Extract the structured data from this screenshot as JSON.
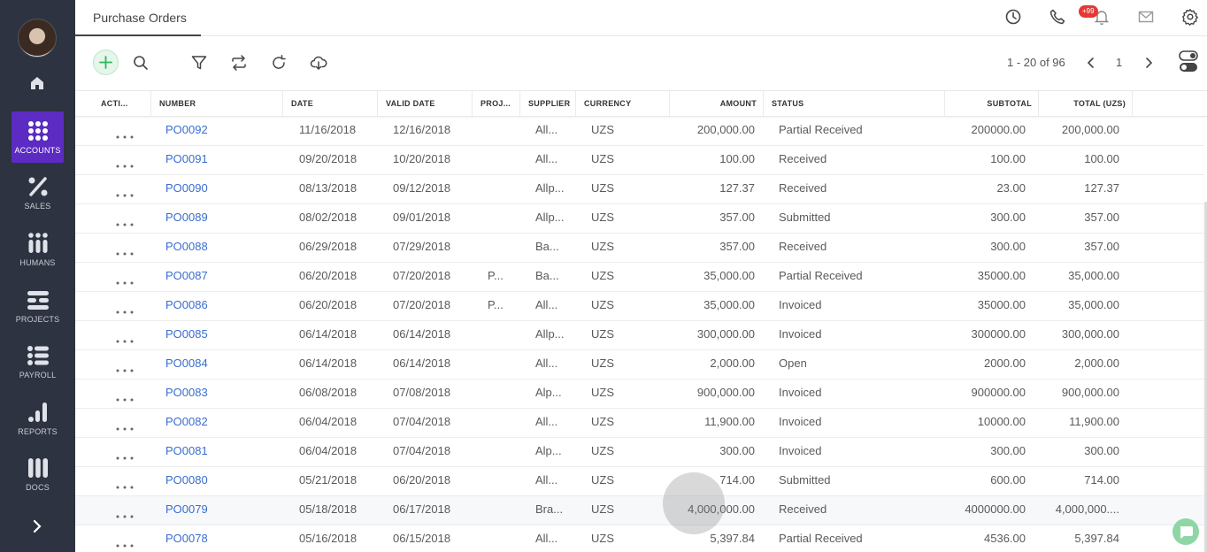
{
  "sidebar": {
    "items": [
      {
        "label": "ACCOUNTS",
        "icon": "grid-dots-icon"
      },
      {
        "label": "SALES",
        "icon": "percent-icon"
      },
      {
        "label": "HUMANS",
        "icon": "people-icon"
      },
      {
        "label": "PROJECTS",
        "icon": "projects-icon"
      },
      {
        "label": "PAYROLL",
        "icon": "payroll-list-icon"
      },
      {
        "label": "REPORTS",
        "icon": "bar-chart-icon"
      },
      {
        "label": "DOCS",
        "icon": "docs-icon"
      }
    ]
  },
  "header": {
    "tab": "Purchase Orders",
    "notification_badge": "+99"
  },
  "toolbar": {
    "pager_range": "1 - 20 of 96",
    "page_number": "1"
  },
  "table": {
    "columns": [
      "ACTI...",
      "NUMBER",
      "DATE",
      "VALID DATE",
      "PROJ...",
      "SUPPLIER",
      "CURRENCY",
      "AMOUNT",
      "STATUS",
      "SUBTOTAL",
      "TOTAL (UZS)"
    ],
    "rows": [
      {
        "number": "PO0092",
        "date": "11/16/2018",
        "valid": "12/16/2018",
        "proj": "",
        "supplier": "All...",
        "currency": "UZS",
        "amount": "200,000.00",
        "status": "Partial Received",
        "subtotal": "200000.00",
        "total": "200,000.00"
      },
      {
        "number": "PO0091",
        "date": "09/20/2018",
        "valid": "10/20/2018",
        "proj": "",
        "supplier": "All...",
        "currency": "UZS",
        "amount": "100.00",
        "status": "Received",
        "subtotal": "100.00",
        "total": "100.00"
      },
      {
        "number": "PO0090",
        "date": "08/13/2018",
        "valid": "09/12/2018",
        "proj": "",
        "supplier": "Allp...",
        "currency": "UZS",
        "amount": "127.37",
        "status": "Received",
        "subtotal": "23.00",
        "total": "127.37"
      },
      {
        "number": "PO0089",
        "date": "08/02/2018",
        "valid": "09/01/2018",
        "proj": "",
        "supplier": "Allp...",
        "currency": "UZS",
        "amount": "357.00",
        "status": "Submitted",
        "subtotal": "300.00",
        "total": "357.00"
      },
      {
        "number": "PO0088",
        "date": "06/29/2018",
        "valid": "07/29/2018",
        "proj": "",
        "supplier": "Ba...",
        "currency": "UZS",
        "amount": "357.00",
        "status": "Received",
        "subtotal": "300.00",
        "total": "357.00"
      },
      {
        "number": "PO0087",
        "date": "06/20/2018",
        "valid": "07/20/2018",
        "proj": "P...",
        "supplier": "Ba...",
        "currency": "UZS",
        "amount": "35,000.00",
        "status": "Partial Received",
        "subtotal": "35000.00",
        "total": "35,000.00"
      },
      {
        "number": "PO0086",
        "date": "06/20/2018",
        "valid": "07/20/2018",
        "proj": "P...",
        "supplier": "All...",
        "currency": "UZS",
        "amount": "35,000.00",
        "status": "Invoiced",
        "subtotal": "35000.00",
        "total": "35,000.00"
      },
      {
        "number": "PO0085",
        "date": "06/14/2018",
        "valid": "06/14/2018",
        "proj": "",
        "supplier": "Allp...",
        "currency": "UZS",
        "amount": "300,000.00",
        "status": "Invoiced",
        "subtotal": "300000.00",
        "total": "300,000.00"
      },
      {
        "number": "PO0084",
        "date": "06/14/2018",
        "valid": "06/14/2018",
        "proj": "",
        "supplier": "All...",
        "currency": "UZS",
        "amount": "2,000.00",
        "status": "Open",
        "subtotal": "2000.00",
        "total": "2,000.00"
      },
      {
        "number": "PO0083",
        "date": "06/08/2018",
        "valid": "07/08/2018",
        "proj": "",
        "supplier": "Alp...",
        "currency": "UZS",
        "amount": "900,000.00",
        "status": "Invoiced",
        "subtotal": "900000.00",
        "total": "900,000.00"
      },
      {
        "number": "PO0082",
        "date": "06/04/2018",
        "valid": "07/04/2018",
        "proj": "",
        "supplier": "All...",
        "currency": "UZS",
        "amount": "11,900.00",
        "status": "Invoiced",
        "subtotal": "10000.00",
        "total": "11,900.00"
      },
      {
        "number": "PO0081",
        "date": "06/04/2018",
        "valid": "07/04/2018",
        "proj": "",
        "supplier": "Alp...",
        "currency": "UZS",
        "amount": "300.00",
        "status": "Invoiced",
        "subtotal": "300.00",
        "total": "300.00"
      },
      {
        "number": "PO0080",
        "date": "05/21/2018",
        "valid": "06/20/2018",
        "proj": "",
        "supplier": "All...",
        "currency": "UZS",
        "amount": "714.00",
        "status": "Submitted",
        "subtotal": "600.00",
        "total": "714.00"
      },
      {
        "number": "PO0079",
        "date": "05/18/2018",
        "valid": "06/17/2018",
        "proj": "",
        "supplier": "Bra...",
        "currency": "UZS",
        "amount": "4,000,000.00",
        "status": "Received",
        "subtotal": "4000000.00",
        "total": "4,000,000...."
      },
      {
        "number": "PO0078",
        "date": "05/16/2018",
        "valid": "06/15/2018",
        "proj": "",
        "supplier": "All...",
        "currency": "UZS",
        "amount": "5,397.84",
        "status": "Partial Received",
        "subtotal": "4536.00",
        "total": "5,397.84"
      }
    ]
  },
  "colors": {
    "sidebar_bg": "#2d3340",
    "active_nav": "#5b2bc2",
    "link": "#3a6ecf",
    "add_green": "#2eb85c",
    "badge_red": "#e53935"
  }
}
